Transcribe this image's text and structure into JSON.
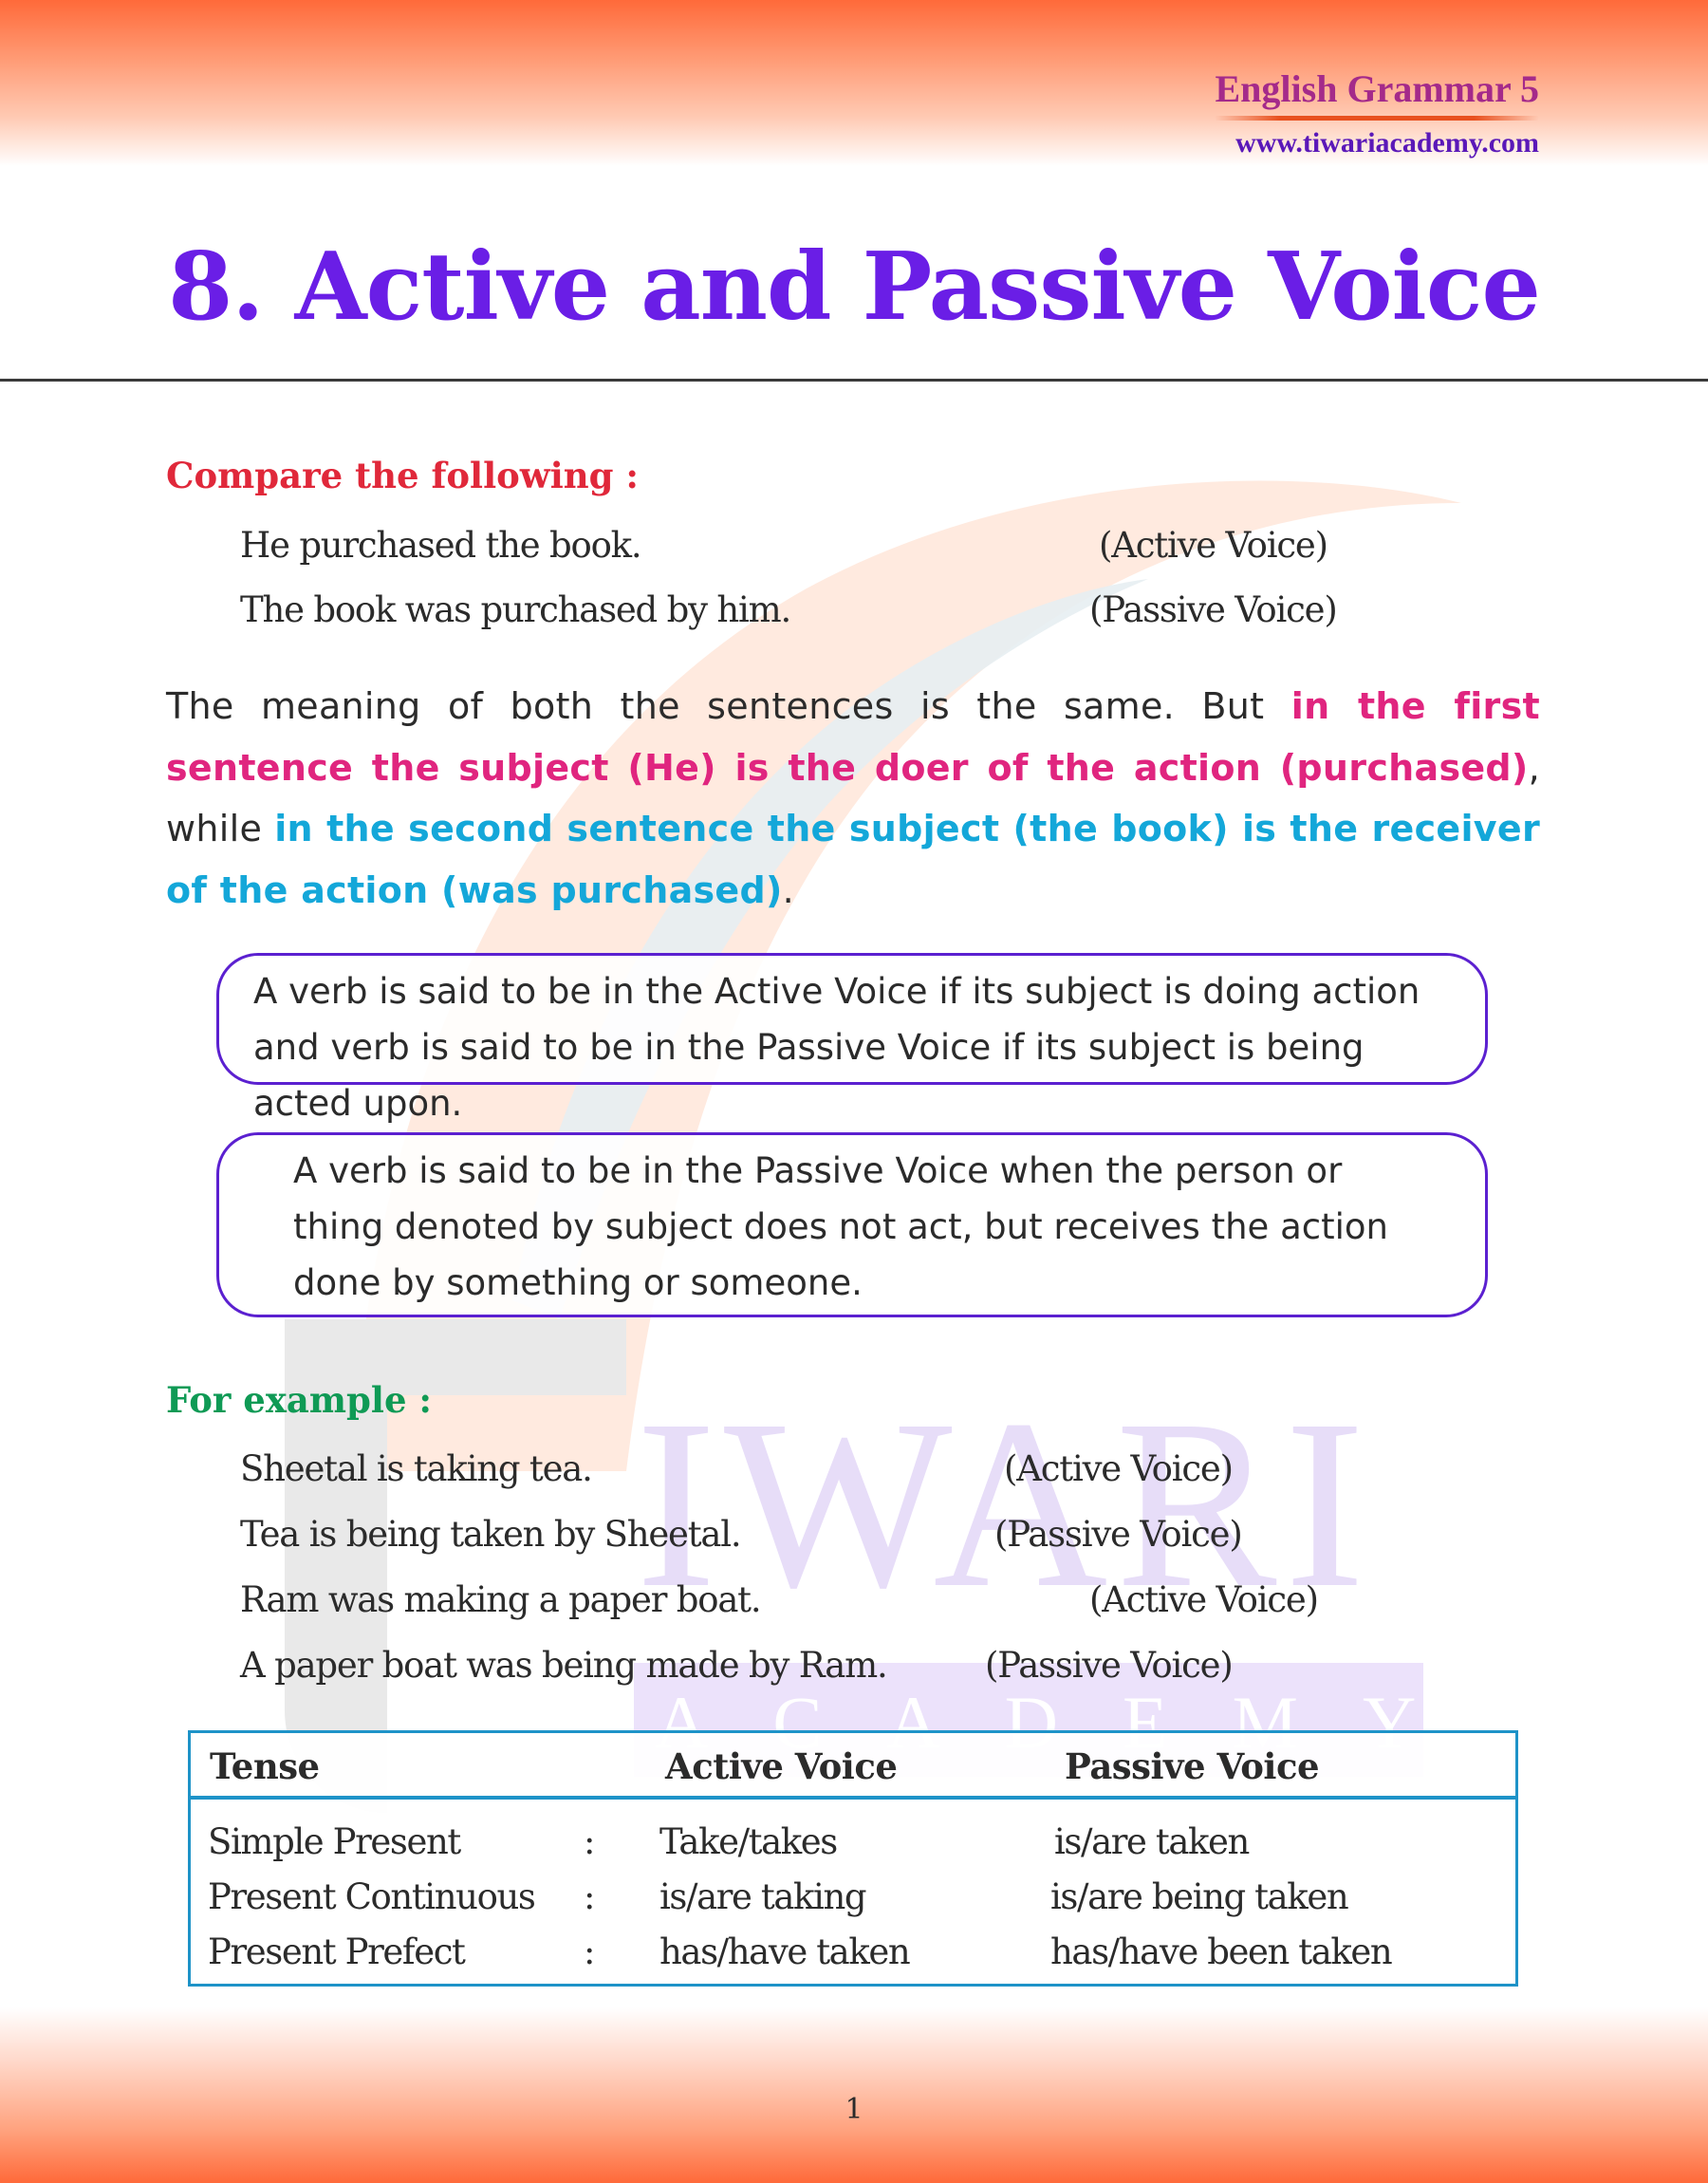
{
  "header": {
    "brand_title": "English Grammar 5",
    "brand_url": "www.tiwariacademy.com"
  },
  "title": "8. Active and Passive Voice",
  "watermark": {
    "big_letters": "IWARI",
    "small_letters": "ACADEMY"
  },
  "compare": {
    "heading": "Compare the following :",
    "rows": [
      {
        "sentence": "He purchased the book.",
        "voice": "(Active Voice)"
      },
      {
        "sentence": "The book was purchased by him.",
        "voice": "(Passive Voice)"
      }
    ]
  },
  "explanation": {
    "plain1": "The meaning of both the sentences is the same. But ",
    "highlight_pink": "in the first sentence the subject (He) is the doer of the action (purchased)",
    "plain2": ", while ",
    "highlight_cyan": "in the second sentence the subject (the book) is the receiver of the action (was purchased)",
    "plain3": "."
  },
  "definitions": [
    {
      "text": "A verb is said to be in the Active Voice if its subject is doing action and verb is said to be in the Passive Voice if its subject is being acted upon."
    },
    {
      "text": "A verb is said to be in the Passive Voice when the person or thing denoted by subject does not act, but receives the action done by something or someone."
    }
  ],
  "examples": {
    "heading": "For example :",
    "rows": [
      {
        "sentence": "Sheetal is taking tea.",
        "voice": "(Active Voice)"
      },
      {
        "sentence": "Tea is being taken by Sheetal.",
        "voice": "(Passive Voice)"
      },
      {
        "sentence": "Ram was making a paper boat.",
        "voice": "(Active Voice)"
      },
      {
        "sentence": "A paper boat was being made by Ram.",
        "voice": "(Passive Voice)"
      }
    ]
  },
  "tense_table": {
    "headers": [
      "Tense",
      "Active Voice",
      "Passive Voice"
    ],
    "separator": ":",
    "rows": [
      {
        "tense": "Simple Present",
        "active": "Take/takes",
        "passive": "is/are taken"
      },
      {
        "tense": "Present Continuous",
        "active": "is/are taking",
        "passive": "is/are being taken"
      },
      {
        "tense": "Present Prefect",
        "active": "has/have taken",
        "passive": "has/have been taken"
      }
    ]
  },
  "footer": {
    "page_number": "1"
  },
  "colors": {
    "title": "#6a1ee6",
    "compare_heading": "#e0283a",
    "example_heading": "#0f9a55",
    "highlight_pink": "#e0257f",
    "highlight_cyan": "#14a7d9",
    "box_border": "#5b20d0",
    "table_border": "#1e93c8",
    "header_gradient": "#ff6a3a"
  }
}
